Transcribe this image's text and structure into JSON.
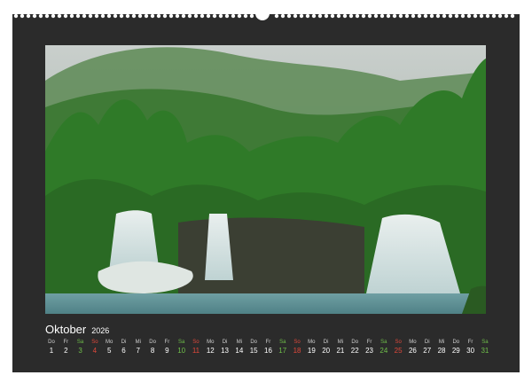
{
  "calendar": {
    "month": "Oktober",
    "year": "2026",
    "photo_subject": "waterfalls in green forest",
    "colors": {
      "frame": "#2b2b2b",
      "saturday": "#6fbf4a",
      "sunday": "#e0483b",
      "weekday": "#ffffff"
    },
    "days": [
      {
        "dow": "Do",
        "num": "1",
        "type": "weekday"
      },
      {
        "dow": "Fr",
        "num": "2",
        "type": "weekday"
      },
      {
        "dow": "Sa",
        "num": "3",
        "type": "sat"
      },
      {
        "dow": "So",
        "num": "4",
        "type": "sun"
      },
      {
        "dow": "Mo",
        "num": "5",
        "type": "weekday"
      },
      {
        "dow": "Di",
        "num": "6",
        "type": "weekday"
      },
      {
        "dow": "Mi",
        "num": "7",
        "type": "weekday"
      },
      {
        "dow": "Do",
        "num": "8",
        "type": "weekday"
      },
      {
        "dow": "Fr",
        "num": "9",
        "type": "weekday"
      },
      {
        "dow": "Sa",
        "num": "10",
        "type": "sat"
      },
      {
        "dow": "So",
        "num": "11",
        "type": "sun"
      },
      {
        "dow": "Mo",
        "num": "12",
        "type": "weekday"
      },
      {
        "dow": "Di",
        "num": "13",
        "type": "weekday"
      },
      {
        "dow": "Mi",
        "num": "14",
        "type": "weekday"
      },
      {
        "dow": "Do",
        "num": "15",
        "type": "weekday"
      },
      {
        "dow": "Fr",
        "num": "16",
        "type": "weekday"
      },
      {
        "dow": "Sa",
        "num": "17",
        "type": "sat"
      },
      {
        "dow": "So",
        "num": "18",
        "type": "sun"
      },
      {
        "dow": "Mo",
        "num": "19",
        "type": "weekday"
      },
      {
        "dow": "Di",
        "num": "20",
        "type": "weekday"
      },
      {
        "dow": "Mi",
        "num": "21",
        "type": "weekday"
      },
      {
        "dow": "Do",
        "num": "22",
        "type": "weekday"
      },
      {
        "dow": "Fr",
        "num": "23",
        "type": "weekday"
      },
      {
        "dow": "Sa",
        "num": "24",
        "type": "sat"
      },
      {
        "dow": "So",
        "num": "25",
        "type": "sun"
      },
      {
        "dow": "Mo",
        "num": "26",
        "type": "weekday"
      },
      {
        "dow": "Di",
        "num": "27",
        "type": "weekday"
      },
      {
        "dow": "Mi",
        "num": "28",
        "type": "weekday"
      },
      {
        "dow": "Do",
        "num": "29",
        "type": "weekday"
      },
      {
        "dow": "Fr",
        "num": "30",
        "type": "weekday"
      },
      {
        "dow": "Sa",
        "num": "31",
        "type": "sat"
      }
    ]
  }
}
